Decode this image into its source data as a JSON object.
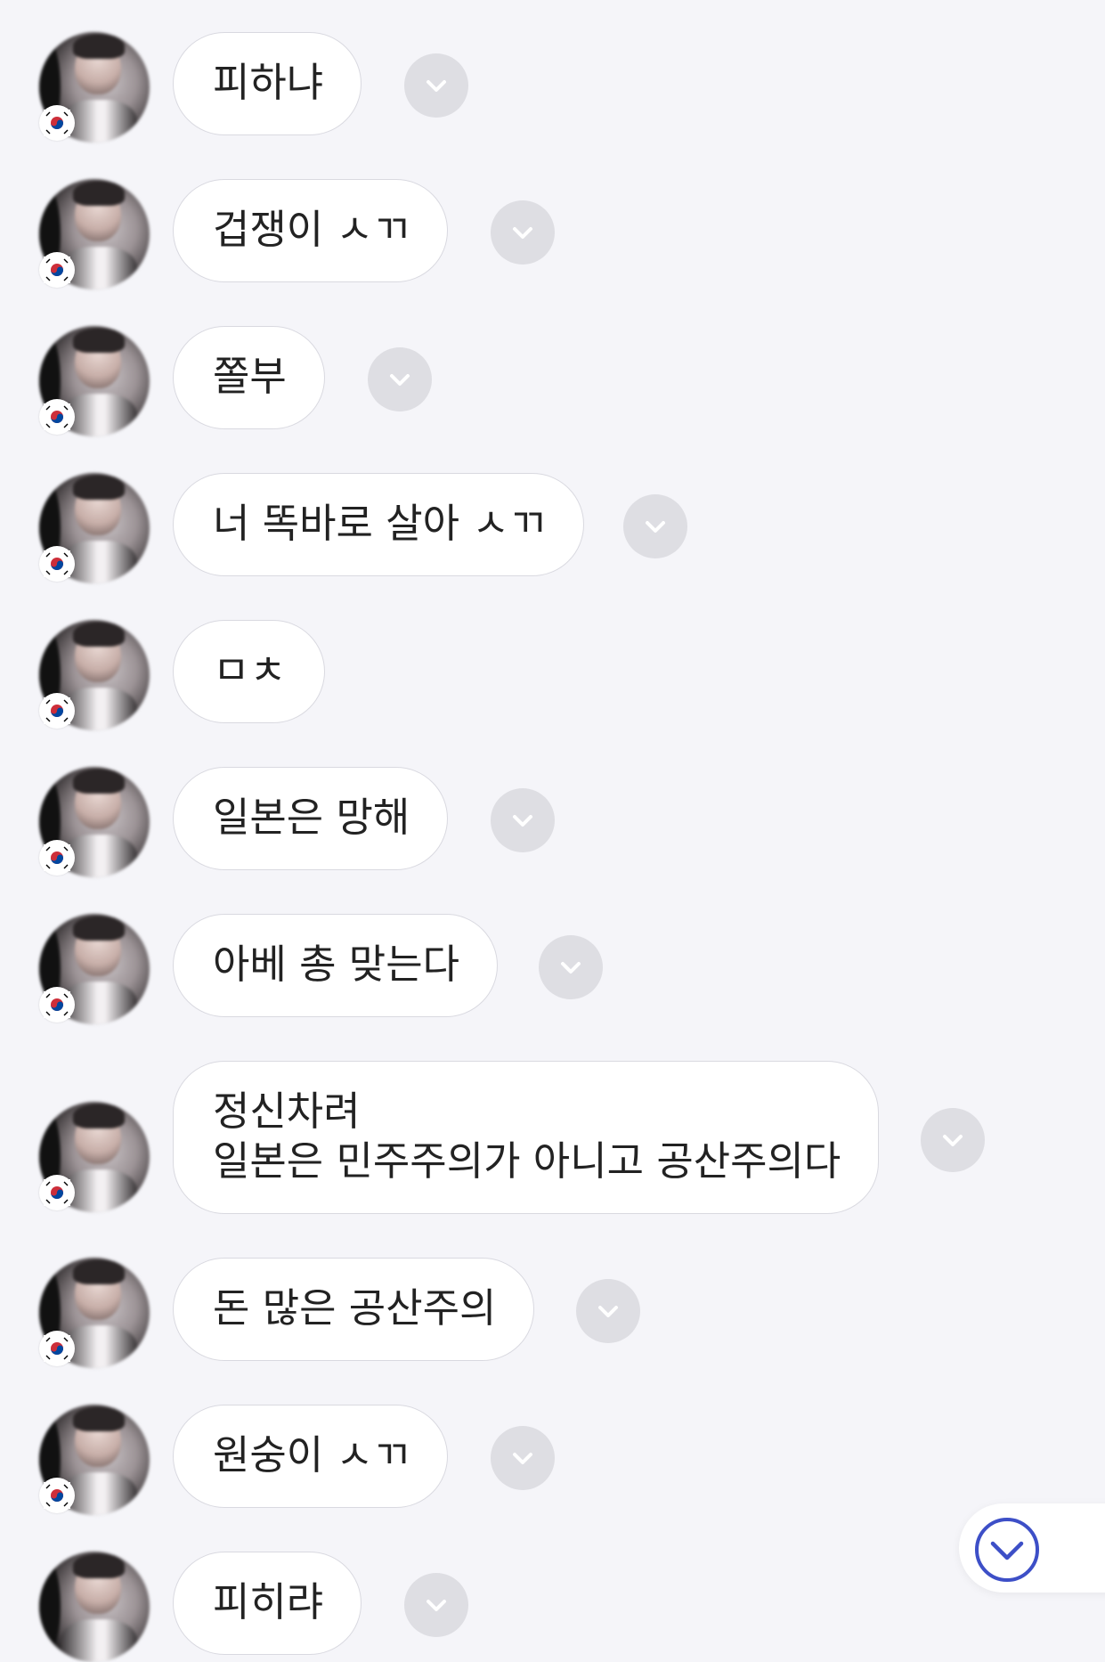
{
  "colors": {
    "background": "#f5f5f9",
    "bubble": "#ffffff",
    "bubble_border": "#d9d9e0",
    "text": "#222222",
    "menu_button": "#dedee3",
    "accent": "#3d4fc7"
  },
  "messages": [
    {
      "lines": [
        "피하냐"
      ],
      "has_menu": true
    },
    {
      "lines": [
        "겁쟁이 ㅅㄲ"
      ],
      "has_menu": true
    },
    {
      "lines": [
        "쫄부"
      ],
      "has_menu": true
    },
    {
      "lines": [
        "너 똑바로 살아 ㅅㄲ"
      ],
      "has_menu": true
    },
    {
      "lines": [
        "ㅁㅊ"
      ],
      "has_menu": false
    },
    {
      "lines": [
        "일본은 망해"
      ],
      "has_menu": true
    },
    {
      "lines": [
        "아베 총 맞는다"
      ],
      "has_menu": true
    },
    {
      "lines": [
        "정신차려",
        "일본은 민주주의가 아니고 공산주의다"
      ],
      "has_menu": true
    },
    {
      "lines": [
        "돈 많은 공산주의"
      ],
      "has_menu": true
    },
    {
      "lines": [
        "원숭이 ㅅㄲ"
      ],
      "has_menu": true
    },
    {
      "lines": [
        "피히랴"
      ],
      "has_menu": true
    }
  ],
  "icons": {
    "avatar": "user-avatar",
    "badge": "korea-flag-icon",
    "menu": "chevron-down-icon",
    "scroll": "scroll-down-icon"
  }
}
